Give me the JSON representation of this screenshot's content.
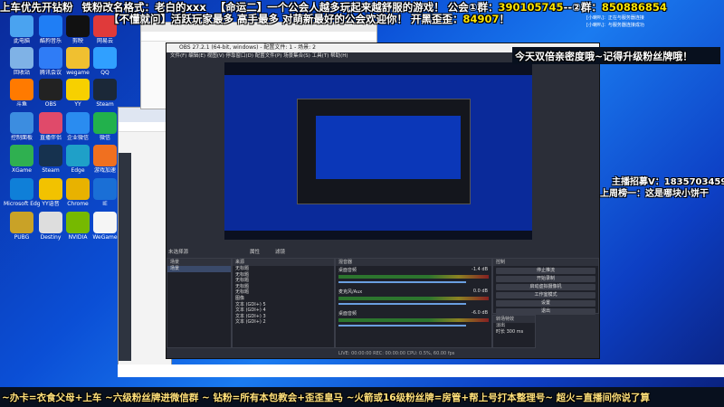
{
  "top_banner": {
    "line1_a": "上车优先开钻粉",
    "line1_b": "铁粉改名格式：老白的xxx",
    "line1_c": "【命运二】一个公会人越多玩起来越舒服的游戏！ 公会①群：",
    "group1": "390105745",
    "line1_d": "--②群：",
    "group2": "850886854",
    "line2_a": "【不懂就问】活跃玩家最多 高手最多 对萌新最好的公会欢迎你！ 开黑歪歪：",
    "yy": "84907",
    "line2_b": "！"
  },
  "right_overlay": {
    "promo": "今天双倍亲密度哦~记得升级粉丝牌哦！",
    "contact": "主播招募V：1835703459",
    "rank": "上周榜一：这是哪块小饼干"
  },
  "corner_small": {
    "line1": "[小喇叭]：正在与服务器连接",
    "line2": "[小喇叭]：与服务器连接成功"
  },
  "bottom_ticker": "~办卡=衣食父母+上车 ~六级粉丝牌进微信群 ~ 钻粉=所有本包教会+歪歪皇马 ~火箭或16级粉丝牌=房管+帮上号打本整理号~ 超火=直播间你说了算",
  "desktop_icons": [
    {
      "label": "此电脑",
      "color": "#4aa3f0"
    },
    {
      "label": "酷狗音乐",
      "color": "#1f7ef5"
    },
    {
      "label": "剪映",
      "color": "#111111"
    },
    {
      "label": "网易云",
      "color": "#e03a3a"
    },
    {
      "label": "回收站",
      "color": "#7fb2e6"
    },
    {
      "label": "腾讯会议",
      "color": "#2f7cf6"
    },
    {
      "label": "wegame",
      "color": "#f0c030"
    },
    {
      "label": "QQ",
      "color": "#30a0ff"
    },
    {
      "label": "斗鱼",
      "color": "#ff7a00"
    },
    {
      "label": "OBS",
      "color": "#222222"
    },
    {
      "label": "YY",
      "color": "#f7d000"
    },
    {
      "label": "Steam",
      "color": "#1b2838"
    },
    {
      "label": "控制面板",
      "color": "#3c8de0"
    },
    {
      "label": "直播伴侣",
      "color": "#e04a6a"
    },
    {
      "label": "企业微信",
      "color": "#2a8cf0"
    },
    {
      "label": "微信",
      "color": "#22b14c"
    },
    {
      "label": "XGame",
      "color": "#2fb050"
    },
    {
      "label": "Steam",
      "color": "#16324f"
    },
    {
      "label": "Edge",
      "color": "#1fa0c8"
    },
    {
      "label": "游戏加速",
      "color": "#f07020"
    },
    {
      "label": "Microsoft Edge",
      "color": "#0f7fd8"
    },
    {
      "label": "YY语音",
      "color": "#f2c200"
    },
    {
      "label": "Chrome",
      "color": "#e8b200"
    },
    {
      "label": "IE",
      "color": "#1a6fd6"
    },
    {
      "label": "PUBG",
      "color": "#c9a227"
    },
    {
      "label": "Destiny",
      "color": "#dddddd"
    },
    {
      "label": "NVIDIA",
      "color": "#76b900"
    },
    {
      "label": "WeGame",
      "color": "#f5f5f5"
    }
  ],
  "obs": {
    "title": "OBS 27.2.1 (64-bit, windows) - 配置文件: 1 - 场景: 2",
    "menu": "文件(F)  编辑(E)  视图(V)  停靠窗口(D)  配置文件(P)  场景集合(S)  工具(T)  帮助(H)",
    "no_source": "未选择源",
    "properties": "属性",
    "filters": "滤镜",
    "docks": {
      "scenes": "场景",
      "sources": "来源",
      "mixer": "混音器",
      "transitions": "转场特效",
      "controls": "控制"
    },
    "scene_item": "场景",
    "sources": [
      "无标题",
      "无标题",
      "无标题",
      "无标题",
      "无标题",
      "图像",
      "文本 (GDI+) 5",
      "文本 (GDI+) 4",
      "文本 (GDI+) 3",
      "文本 (GDI+) 2"
    ],
    "mixer": [
      {
        "name": "桌面音频",
        "db": "-1.4 dB"
      },
      {
        "name": "麦克风/Aux",
        "db": "0.0 dB"
      },
      {
        "name": "桌面音频",
        "db": "-6.0 dB"
      }
    ],
    "controls": [
      "停止推流",
      "开始录制",
      "启动虚拟摄像机",
      "工作室模式",
      "设置",
      "退出"
    ],
    "transition": "淡出",
    "duration_label": "时长",
    "duration": "300 ms",
    "status": "LIVE: 00:00:00   REC: 00:00:00   CPU: 0.5%, 60.00 fps"
  }
}
